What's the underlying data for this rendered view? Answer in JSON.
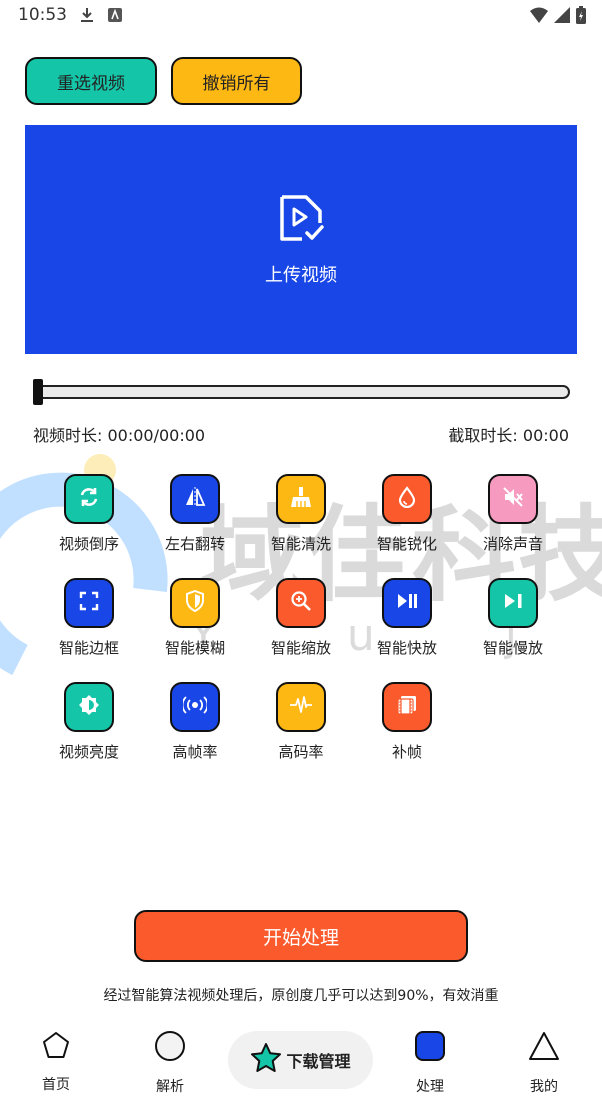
{
  "status_bar": {
    "time": "10:53"
  },
  "toolbar": {
    "reselect_label": "重选视频",
    "undo_label": "撤销所有"
  },
  "upload": {
    "label": "上传视频"
  },
  "timeline": {
    "progress": 0,
    "duration_label": "视频时长: 00:00/00:00",
    "clip_label": "截取时长: 00:00"
  },
  "tools": [
    {
      "label": "视频倒序",
      "icon": "refresh-icon",
      "color": "#14c5a7"
    },
    {
      "label": "左右翻转",
      "icon": "flip-icon",
      "color": "#1946e6"
    },
    {
      "label": "智能清洗",
      "icon": "broom-icon",
      "color": "#fdb814"
    },
    {
      "label": "智能锐化",
      "icon": "drop-icon",
      "color": "#fb5a2d"
    },
    {
      "label": "消除声音",
      "icon": "mute-icon",
      "color": "#f79ac0"
    },
    {
      "label": "智能边框",
      "icon": "frame-icon",
      "color": "#1946e6"
    },
    {
      "label": "智能模糊",
      "icon": "shield-icon",
      "color": "#fdb814"
    },
    {
      "label": "智能缩放",
      "icon": "zoom-icon",
      "color": "#fb5a2d"
    },
    {
      "label": "智能快放",
      "icon": "play-pause-icon",
      "color": "#1946e6"
    },
    {
      "label": "智能慢放",
      "icon": "play-step-icon",
      "color": "#14c5a7"
    },
    {
      "label": "视频亮度",
      "icon": "brightness-icon",
      "color": "#14c5a7"
    },
    {
      "label": "高帧率",
      "icon": "broadcast-icon",
      "color": "#1946e6"
    },
    {
      "label": "高码率",
      "icon": "waveform-icon",
      "color": "#fdb814"
    },
    {
      "label": "补帧",
      "icon": "film-icon",
      "color": "#fb5a2d"
    }
  ],
  "action": {
    "start_label": "开始处理"
  },
  "notice": "经过智能算法视频处理后，原创度几乎可以达到90%，有效消重",
  "watermark": {
    "text": "域佳科技",
    "sub": "Y u j a"
  },
  "nav": {
    "home": "首页",
    "parse": "解析",
    "downloads": "下载管理",
    "process": "处理",
    "mine": "我的"
  }
}
